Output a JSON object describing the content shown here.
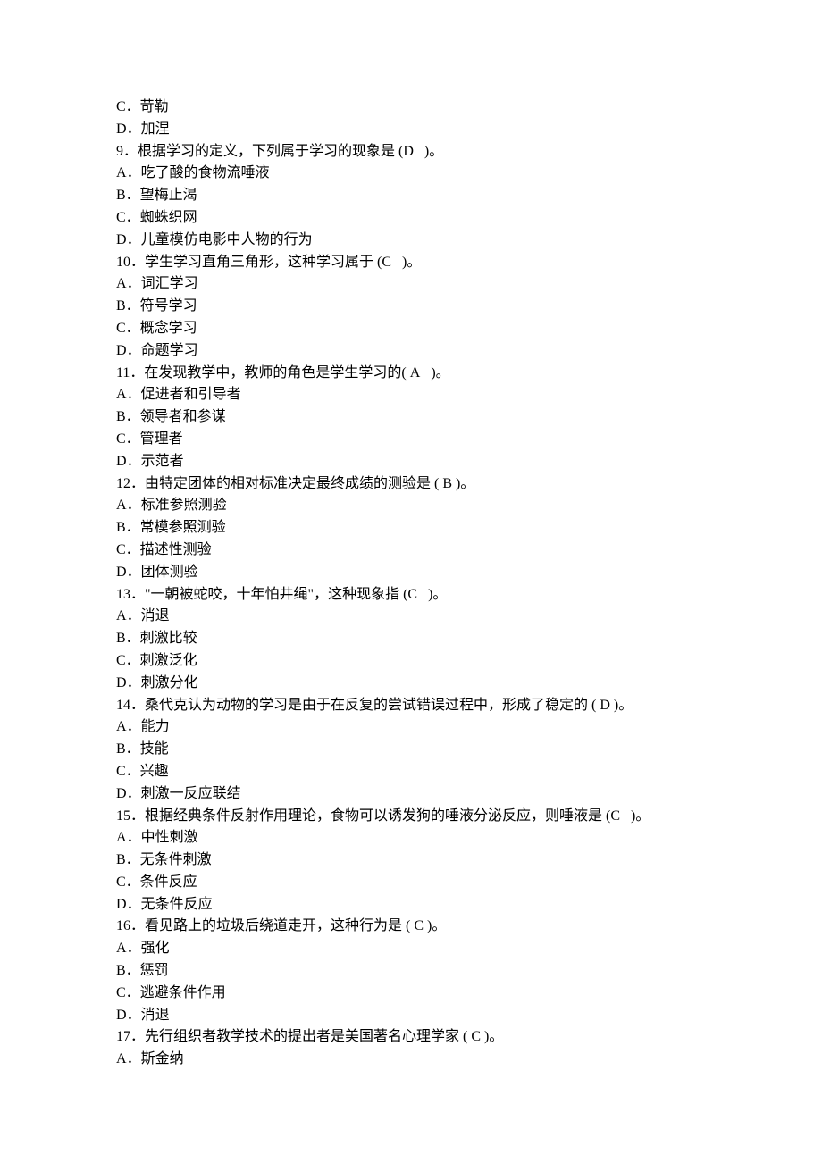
{
  "lines": [
    "C．苛勒",
    "D．加涅",
    "9．根据学习的定义，下列属于学习的现象是 (D   )。",
    "A．吃了酸的食物流唾液",
    "B．望梅止渴",
    "C．蜘蛛织网",
    "D．儿童模仿电影中人物的行为",
    "10．学生学习直角三角形，这种学习属于 (C   )。",
    "A．词汇学习",
    "B．符号学习",
    "C．概念学习",
    "D．命题学习",
    "11．在发现教学中，教师的角色是学生学习的( A   )。",
    "A．促进者和引导者",
    "B．领导者和参谋",
    "C．管理者",
    "D．示范者",
    "12．由特定团体的相对标准决定最终成绩的测验是 ( B )。",
    "A．标准参照测验",
    "B．常模参照测验",
    "C．描述性测验",
    "D．团体测验",
    "13．\"一朝被蛇咬，十年怕井绳\"，这种现象指 (C   )。",
    "A．消退",
    "B．刺激比较",
    "C．刺激泛化",
    "D．刺激分化",
    "14．桑代克认为动物的学习是由于在反复的尝试错误过程中，形成了稳定的 ( D )。",
    "A．能力",
    "B．技能",
    "C．兴趣",
    "D．刺激一反应联结",
    "15．根据经典条件反射作用理论，食物可以诱发狗的唾液分泌反应，则唾液是 (C   )。",
    "A．中性刺激",
    "B．无条件刺激",
    "C．条件反应",
    "D．无条件反应",
    "16．看见路上的垃圾后绕道走开，这种行为是 ( C )。",
    "A．强化",
    "B．惩罚",
    "C．逃避条件作用",
    "D．消退",
    "17．先行组织者教学技术的提出者是美国著名心理学家 ( C )。",
    "A．斯金纳"
  ]
}
